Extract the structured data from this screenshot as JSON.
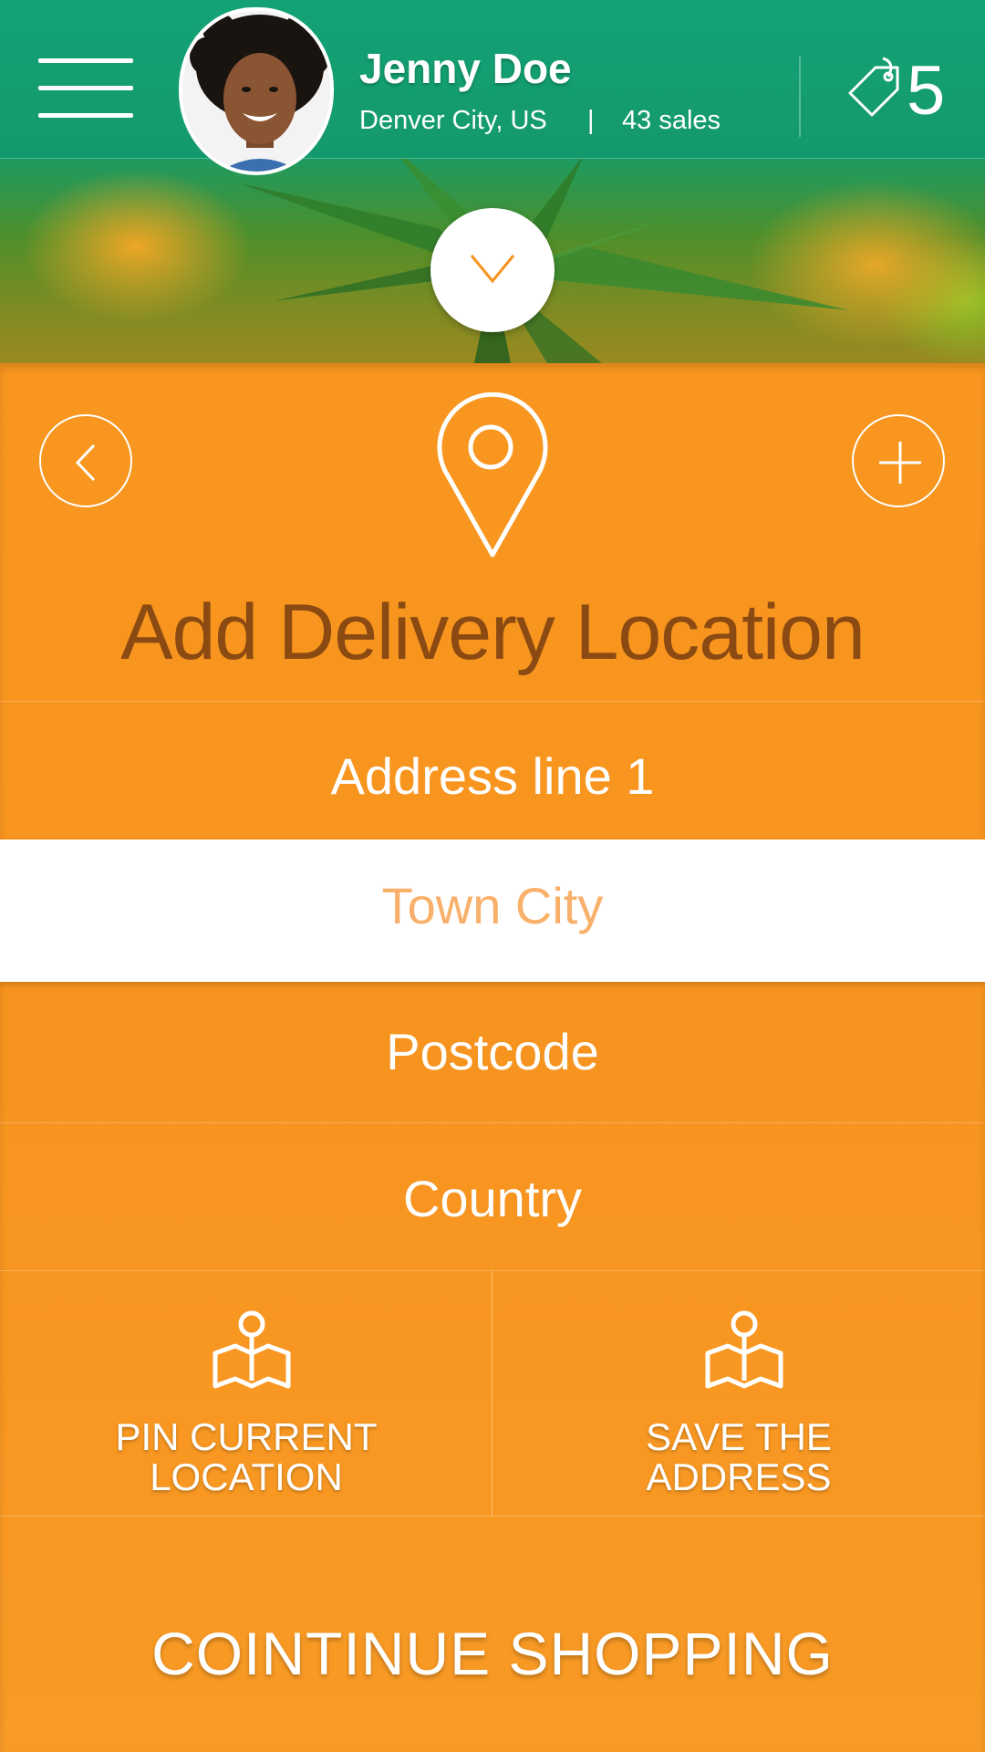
{
  "header": {
    "user_name": "Jenny Doe",
    "location": "Denver City, US",
    "separator": "|",
    "sales": "43 sales",
    "tag_count": "5",
    "icons": [
      "hamburger-menu-icon",
      "price-tag-icon",
      "chevron-down-icon"
    ]
  },
  "panel": {
    "title": "Add Delivery Location",
    "icons": [
      "chevron-left-icon",
      "location-pin-icon",
      "plus-icon"
    ],
    "fields": {
      "address_line_1": "Address line 1",
      "town_city": "Town City",
      "postcode": "Postcode",
      "country": "Country"
    },
    "actions": {
      "pin_current": "PIN CURRENT\nLOCATION",
      "save_address": "SAVE THE\nADDRESS"
    },
    "continue_label": "COINTINUE SHOPPING"
  },
  "colors": {
    "header_green": "#13a276",
    "panel_orange": "#f7931e",
    "title_brown": "#8a4a12",
    "placeholder_orange": "#f9b06a"
  }
}
